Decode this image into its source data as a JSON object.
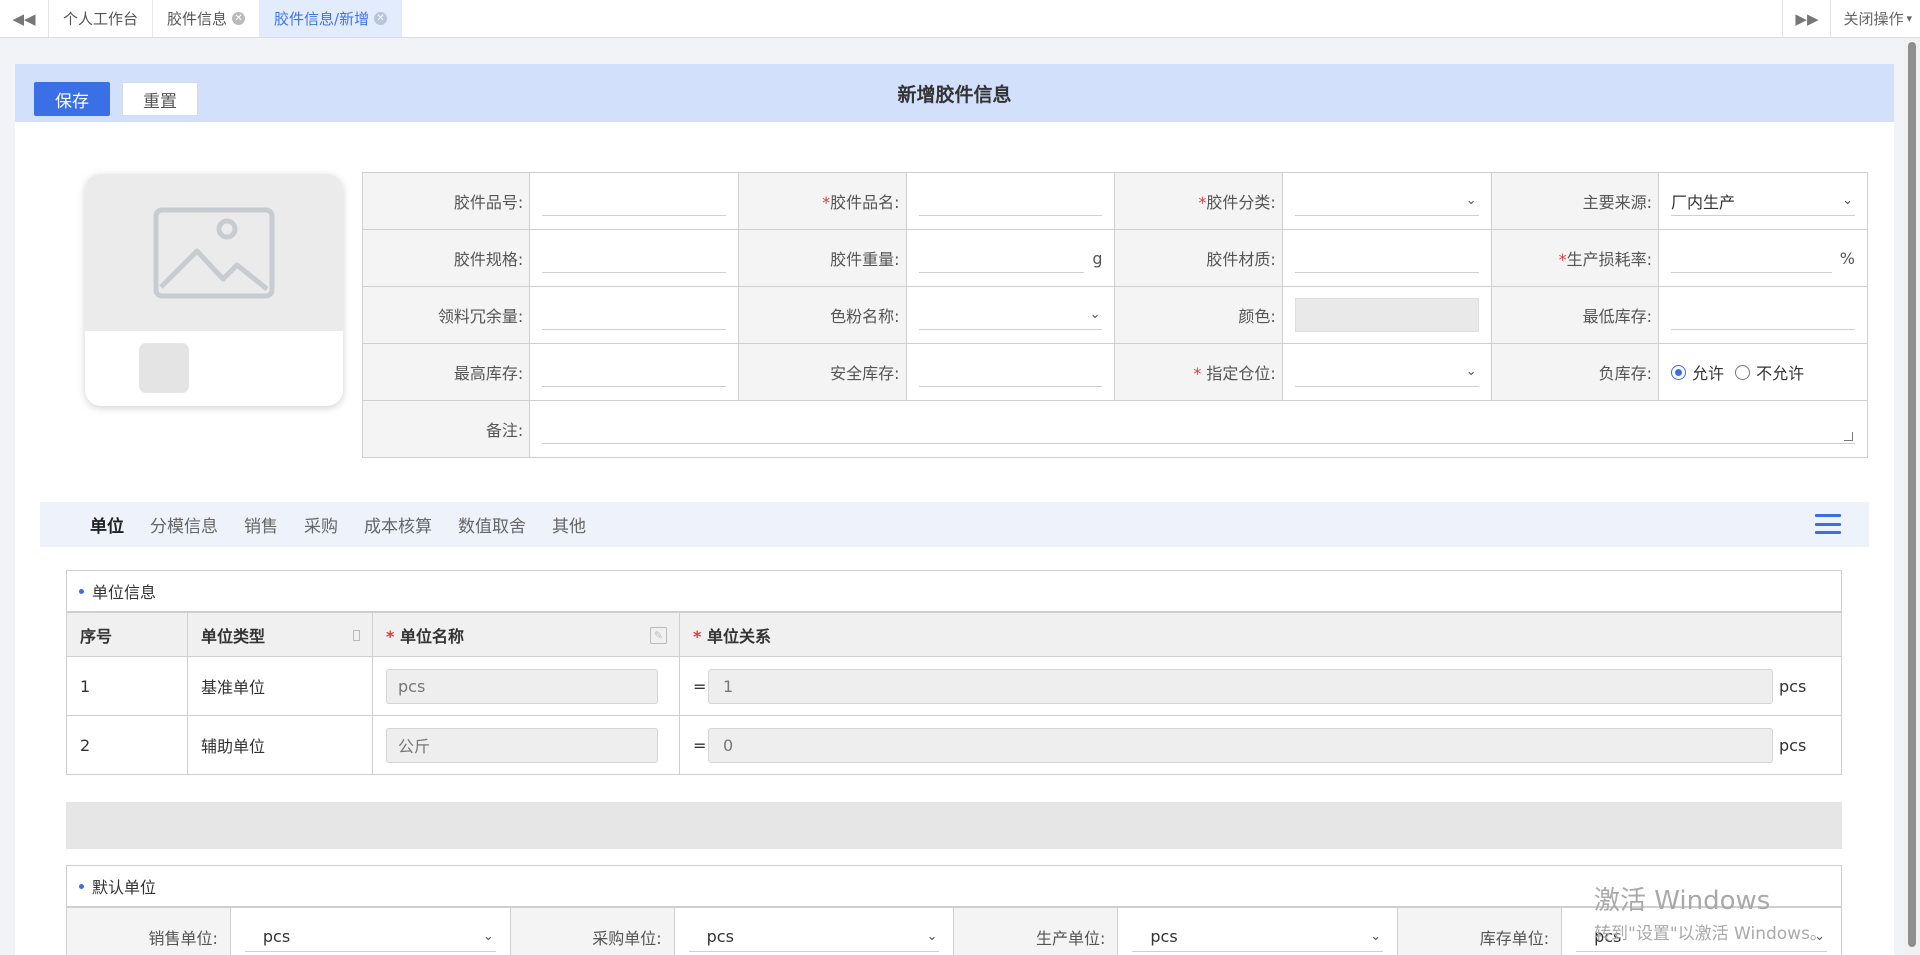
{
  "tabbar": {
    "left_nav_icon": "double-chevron-left",
    "tabs": [
      {
        "label": "个人工作台"
      },
      {
        "label": "胶件信息"
      },
      {
        "label": "胶件信息/新增"
      }
    ],
    "right_nav_icon": "double-chevron-right",
    "close_ops": "关闭操作"
  },
  "header": {
    "save_label": "保存",
    "reset_label": "重置",
    "title": "新增胶件信息"
  },
  "image": {
    "placeholder_icon": "image-placeholder-icon"
  },
  "form": {
    "part_no": {
      "label": "胶件品号:",
      "value": ""
    },
    "part_name": {
      "label": "胶件品名:",
      "value": ""
    },
    "category": {
      "label": "胶件分类:",
      "value": ""
    },
    "source": {
      "label": "主要来源:",
      "value": "厂内生产"
    },
    "spec": {
      "label": "胶件规格:",
      "value": ""
    },
    "weight": {
      "label": "胶件重量:",
      "value": "",
      "unit": "g"
    },
    "material": {
      "label": "胶件材质:",
      "value": ""
    },
    "loss_rate": {
      "label": "生产损耗率:",
      "value": "",
      "unit": "%"
    },
    "redundancy": {
      "label": "领料冗余量:",
      "value": ""
    },
    "toner": {
      "label": "色粉名称:",
      "value": ""
    },
    "color": {
      "label": "颜色:",
      "value": ""
    },
    "min_stock": {
      "label": "最低库存:",
      "value": ""
    },
    "max_stock": {
      "label": "最高库存:",
      "value": ""
    },
    "safety_stock": {
      "label": "安全库存:",
      "value": ""
    },
    "location": {
      "label": " 指定仓位:",
      "value": ""
    },
    "negative_stock": {
      "label": "负库存:",
      "allow": "允许",
      "deny": "不允许",
      "selected": "允许"
    },
    "remark": {
      "label": "备注:",
      "value": ""
    },
    "required_mark": "*"
  },
  "subtabs": [
    "单位",
    "分模信息",
    "销售",
    "采购",
    "成本核算",
    "数值取舍",
    "其他"
  ],
  "units_section": {
    "title": "单位信息",
    "columns": [
      "序号",
      "单位类型",
      "单位名称",
      "单位关系"
    ],
    "rows": [
      {
        "no": "1",
        "type": "基准单位",
        "name": "pcs",
        "eq": "=",
        "rel": "1",
        "unit": "pcs"
      },
      {
        "no": "2",
        "type": "辅助单位",
        "name": "公斤",
        "eq": "=",
        "rel": "0",
        "unit": "pcs"
      }
    ]
  },
  "default_units": {
    "title": "默认单位",
    "sales": {
      "label": "销售单位:",
      "value": "pcs"
    },
    "purchase": {
      "label": "采购单位:",
      "value": "pcs"
    },
    "production": {
      "label": "生产单位:",
      "value": "pcs"
    },
    "stock": {
      "label": "库存单位:",
      "value": "pcs"
    }
  },
  "watermark": {
    "line1": "激活 Windows",
    "line2": "转到\"设置\"以激活 Windows。"
  }
}
